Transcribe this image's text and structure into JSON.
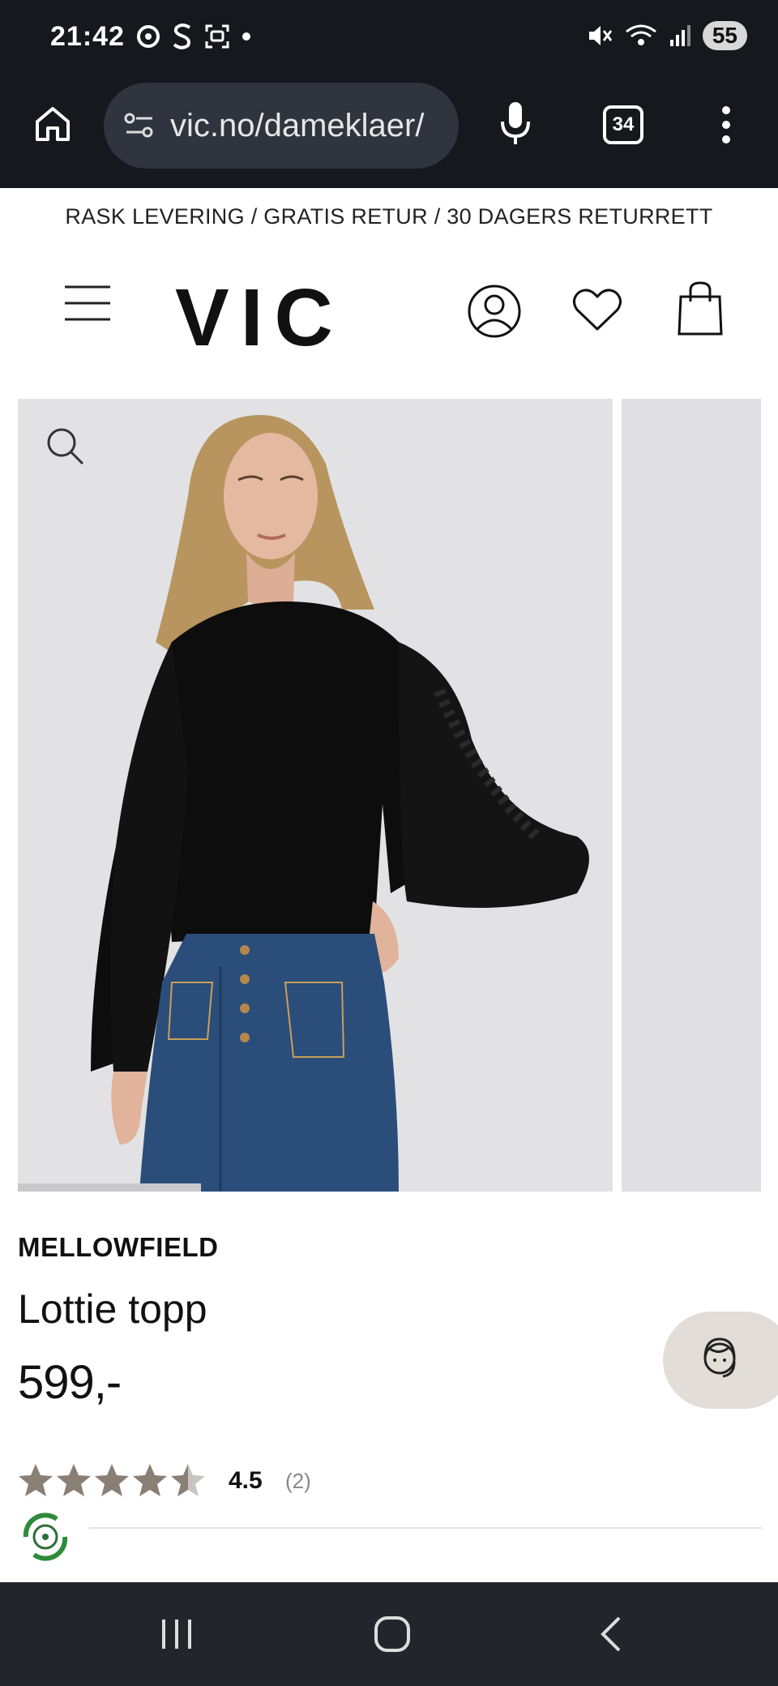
{
  "status": {
    "time": "21:42",
    "battery": "55"
  },
  "browser": {
    "url": "vic.no/dameklaer/",
    "tab_count": "34"
  },
  "promo": {
    "text": "RASK LEVERING / GRATIS RETUR / 30 DAGERS RETURRETT"
  },
  "header": {
    "logo": "VIC"
  },
  "product": {
    "brand": "MELLOWFIELD",
    "name": "Lottie topp",
    "price": "599,-",
    "rating_value": 4.5,
    "rating_text": "4.5",
    "review_count": "(2)"
  },
  "colors": {
    "dark_bar": "#16181d",
    "star": "#8a7f75",
    "chat_bg": "#e3ddd8"
  },
  "icons": [
    "home-icon",
    "site-settings-icon",
    "mic-icon",
    "tabs-icon",
    "more-icon",
    "menu-icon",
    "account-icon",
    "wishlist-icon",
    "cart-icon",
    "zoom-icon",
    "customer-service-icon",
    "eco-badge-icon",
    "recents-icon",
    "home-nav-icon",
    "back-icon"
  ]
}
